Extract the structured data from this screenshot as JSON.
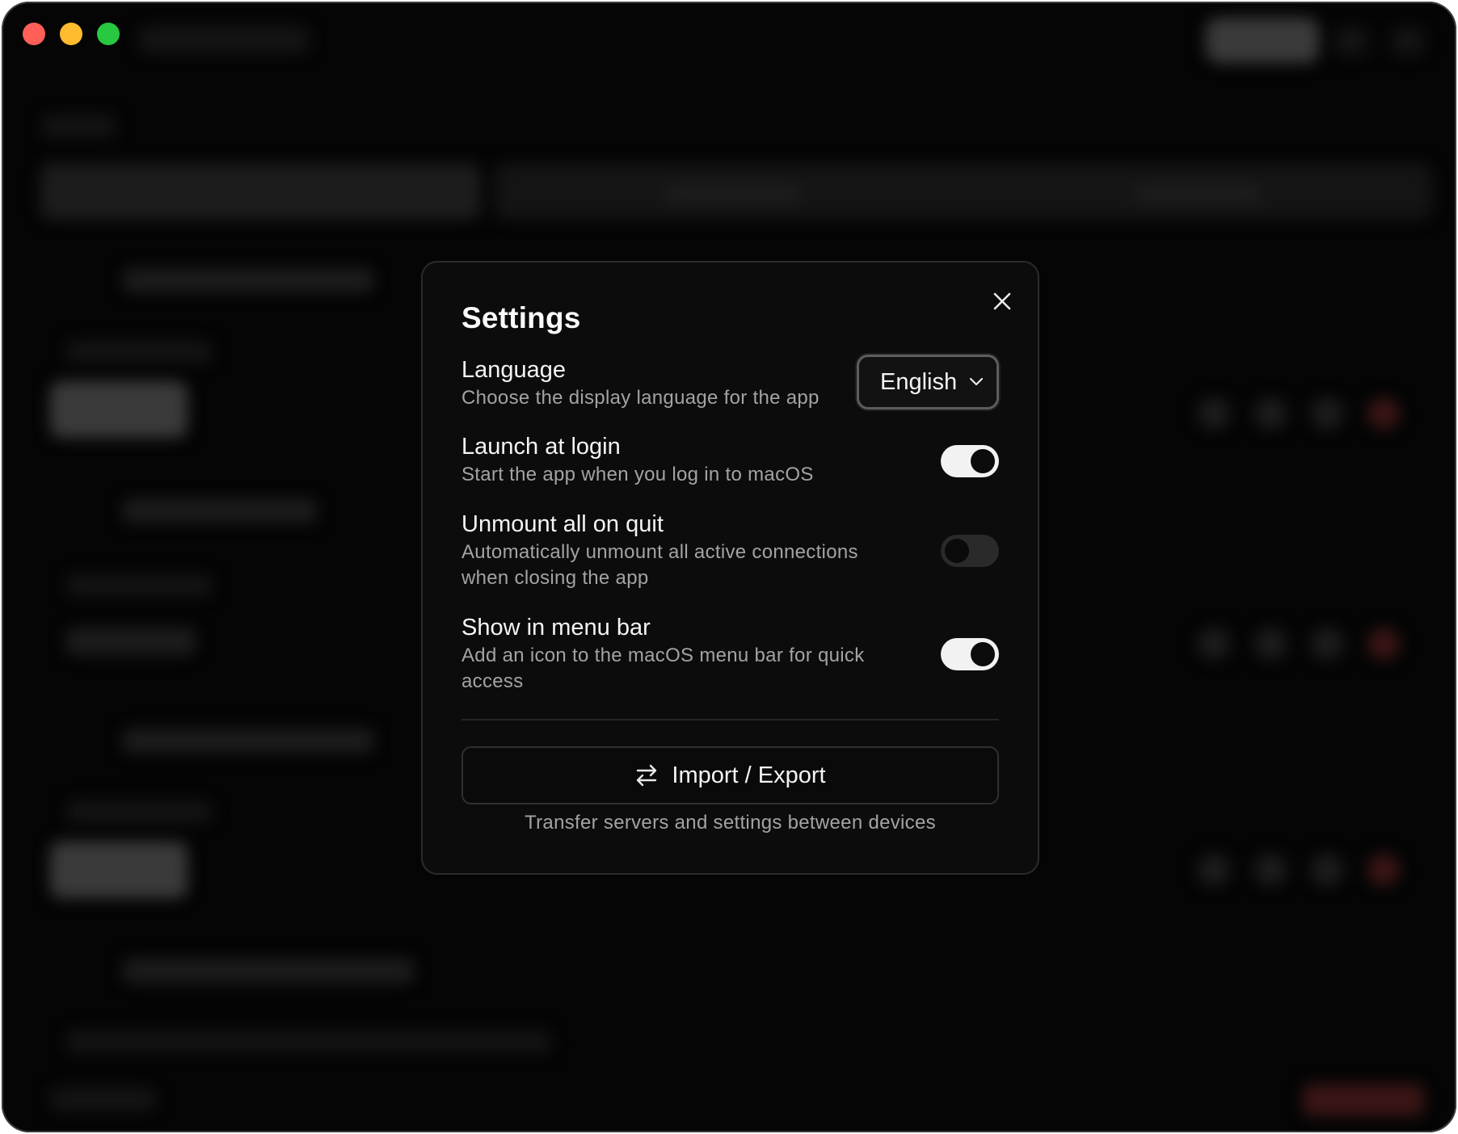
{
  "settings": {
    "title": "Settings",
    "language": {
      "label": "Language",
      "description": "Choose the display language for the app",
      "selected": "English"
    },
    "launch_at_login": {
      "label": "Launch at login",
      "description": "Start the app when you log in to macOS",
      "enabled": true
    },
    "unmount_on_quit": {
      "label": "Unmount all on quit",
      "description": "Automatically unmount all active connections when closing the app",
      "enabled": false
    },
    "menu_bar": {
      "label": "Show in menu bar",
      "description": "Add an icon to the macOS menu bar for quick access",
      "enabled": true
    },
    "import_export": {
      "label": "Import / Export",
      "hint": "Transfer servers and settings between devices"
    }
  },
  "icons": {
    "close": "close-icon",
    "chevron": "chevron-down-icon",
    "transfer": "arrows-left-right-icon"
  },
  "colors": {
    "window_bg": "#050505",
    "modal_bg": "#0c0c0c",
    "toggle_on": "#f2f2f2",
    "toggle_off": "#2a2a2a",
    "traffic_red": "#ff5f57",
    "traffic_yellow": "#febc2e",
    "traffic_green": "#28c840"
  }
}
